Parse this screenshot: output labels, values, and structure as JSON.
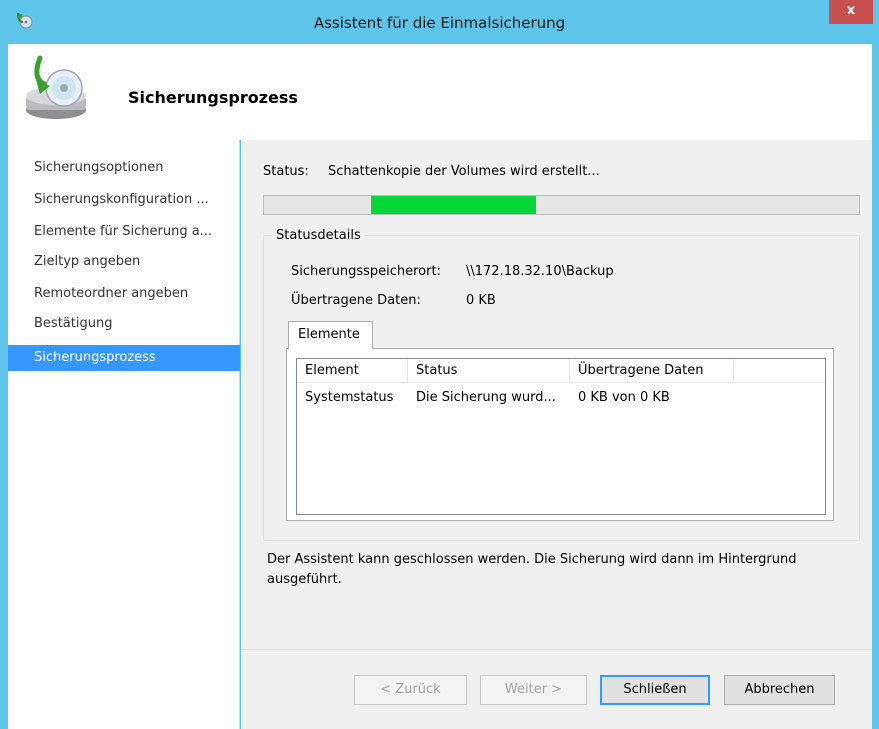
{
  "window": {
    "title": "Assistent für die Einmalsicherung",
    "close_label": "x"
  },
  "header": {
    "title": "Sicherungsprozess"
  },
  "nav": {
    "items": [
      {
        "label": "Sicherungsoptionen",
        "active": false
      },
      {
        "label": "Sicherungskonfiguration ...",
        "active": false
      },
      {
        "label": "Elemente für Sicherung a...",
        "active": false
      },
      {
        "label": "Zieltyp angeben",
        "active": false
      },
      {
        "label": "Remoteordner angeben",
        "active": false
      },
      {
        "label": "Bestätigung",
        "active": false
      },
      {
        "label": "Sicherungsprozess",
        "active": true
      }
    ]
  },
  "status": {
    "label": "Status:",
    "text": "Schattenkopie der Volumes wird erstellt..."
  },
  "details": {
    "group_title": "Statusdetails",
    "location_label": "Sicherungsspeicherort:",
    "location_value": "\\\\172.18.32.10\\Backup",
    "transferred_label": "Übertragene Daten:",
    "transferred_value": "0 KB",
    "tab_label": "Elemente",
    "columns": [
      "Element",
      "Status",
      "Übertragene Daten"
    ],
    "rows": [
      [
        "Systemstatus",
        "Die Sicherung wurd...",
        "0 KB von 0 KB"
      ]
    ]
  },
  "footnote": "Der Assistent kann geschlossen werden. Die Sicherung wird dann im Hintergrund ausgeführt.",
  "buttons": {
    "back": "< Zurück",
    "next": "Weiter >",
    "close": "Schließen",
    "cancel": "Abbrechen"
  },
  "colors": {
    "titlebar": "#5ec4ea",
    "progress_fill": "#06d63a",
    "selection": "#3399ff"
  }
}
